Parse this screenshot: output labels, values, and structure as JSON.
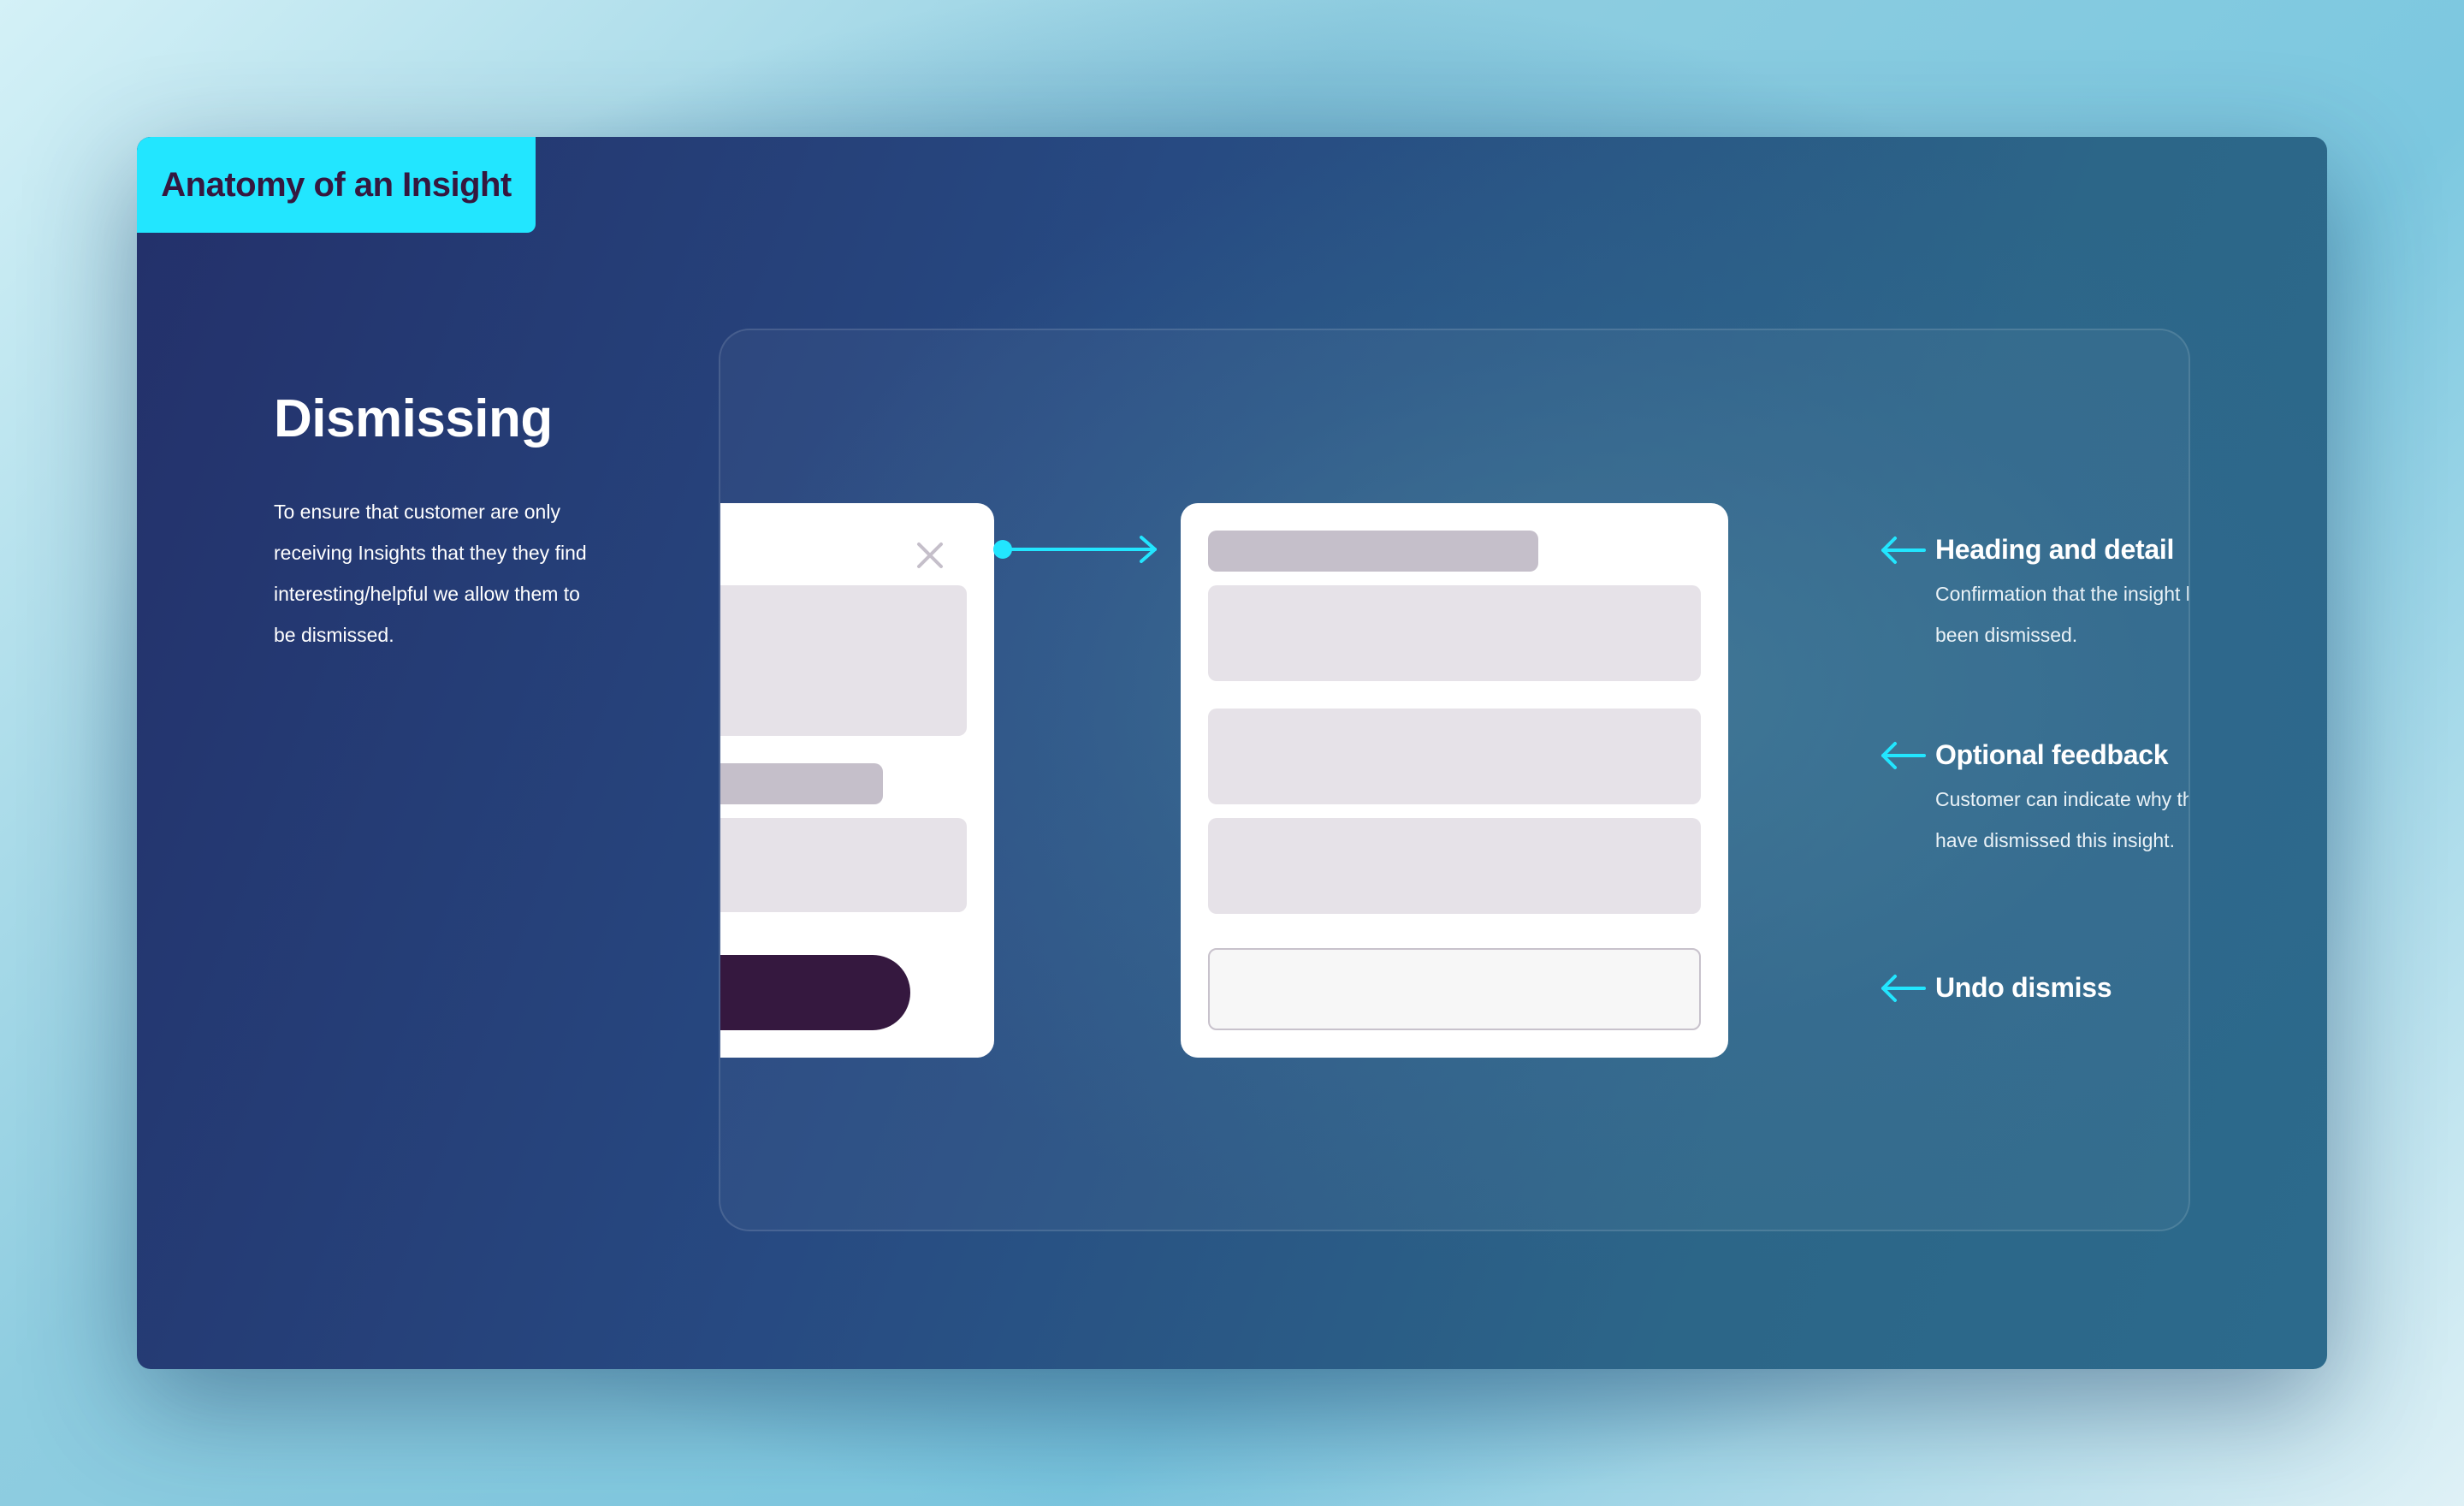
{
  "header": {
    "title": "Anatomy of an Insight"
  },
  "intro": {
    "heading": "Dismissing",
    "body_lines": [
      "To ensure that customer are only",
      "receiving Insights that they they find",
      "interesting/helpful we allow them to",
      "be dismissed."
    ]
  },
  "diagram": {
    "before_card": {
      "close_icon": "close-icon",
      "elements": [
        "content-block",
        "label-bar",
        "content-block",
        "primary-button-pill"
      ]
    },
    "transition_icon": "arrow-right-icon",
    "after_card": {
      "elements": [
        "heading-bar",
        "detail-block",
        "feedback-block",
        "feedback-block",
        "undo-button-outline"
      ]
    }
  },
  "annotations": [
    {
      "icon": "arrow-left-icon",
      "title": "Heading and detail",
      "description_lines": [
        "Confirmation that the insight has",
        "been dismissed."
      ]
    },
    {
      "icon": "arrow-left-icon",
      "title": "Optional feedback",
      "description_lines": [
        "Customer can indicate why they",
        "have dismissed this insight."
      ]
    },
    {
      "icon": "arrow-left-icon",
      "title": "Undo dismiss",
      "description_lines": []
    }
  ],
  "colors": {
    "accent": "#22E6FF",
    "title_text": "#35183F",
    "button_dark": "#35183F",
    "placeholder_light": "#E6E2E8",
    "placeholder_dark": "#C5BFCA",
    "close_icon": "#C5BFCA"
  }
}
